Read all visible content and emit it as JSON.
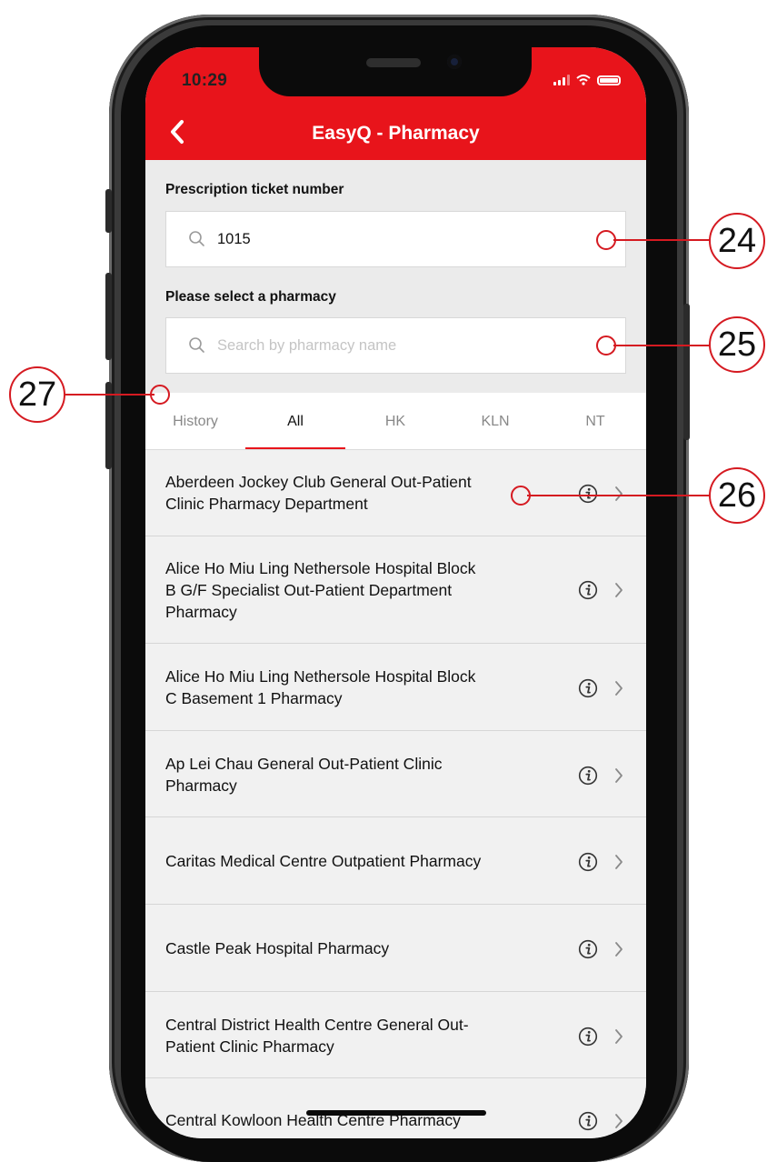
{
  "status": {
    "time": "10:29"
  },
  "header": {
    "title": "EasyQ - Pharmacy"
  },
  "ticket": {
    "label": "Prescription ticket number",
    "value": "1015"
  },
  "pharmacy_search": {
    "label": "Please select a pharmacy",
    "placeholder": "Search by pharmacy name"
  },
  "tabs": [
    {
      "label": "History"
    },
    {
      "label": "All",
      "active": true
    },
    {
      "label": "HK"
    },
    {
      "label": "KLN"
    },
    {
      "label": "NT"
    }
  ],
  "pharmacies": [
    {
      "line1": "Aberdeen Jockey Club General Out-Patient",
      "line2": "Clinic Pharmacy Department",
      "line3": ""
    },
    {
      "line1": "Alice Ho Miu Ling Nethersole Hospital Block",
      "line2": "B G/F Specialist Out-Patient Department",
      "line3": "Pharmacy"
    },
    {
      "line1": "Alice Ho Miu Ling Nethersole Hospital Block",
      "line2": "C Basement 1 Pharmacy",
      "line3": ""
    },
    {
      "line1": "Ap Lei Chau General Out-Patient Clinic",
      "line2": "Pharmacy",
      "line3": ""
    },
    {
      "line1": "Caritas Medical Centre Outpatient Pharmacy",
      "line2": "",
      "line3": ""
    },
    {
      "line1": "Castle Peak Hospital Pharmacy",
      "line2": "",
      "line3": ""
    },
    {
      "line1": "Central District Health Centre General Out-",
      "line2": "Patient Clinic Pharmacy",
      "line3": ""
    },
    {
      "line1": "Central Kowloon Health Centre Pharmacy",
      "line2": "",
      "line3": ""
    }
  ],
  "icons": {
    "back": "chevron-left-icon",
    "search": "magnifier-icon",
    "info": "info-circle-icon",
    "row_arrow": "chevron-right-icon"
  },
  "colors": {
    "accent": "#e8141b",
    "callout": "#d51a21"
  },
  "callouts": {
    "c24": "24",
    "c25": "25",
    "c26": "26",
    "c27": "27"
  }
}
